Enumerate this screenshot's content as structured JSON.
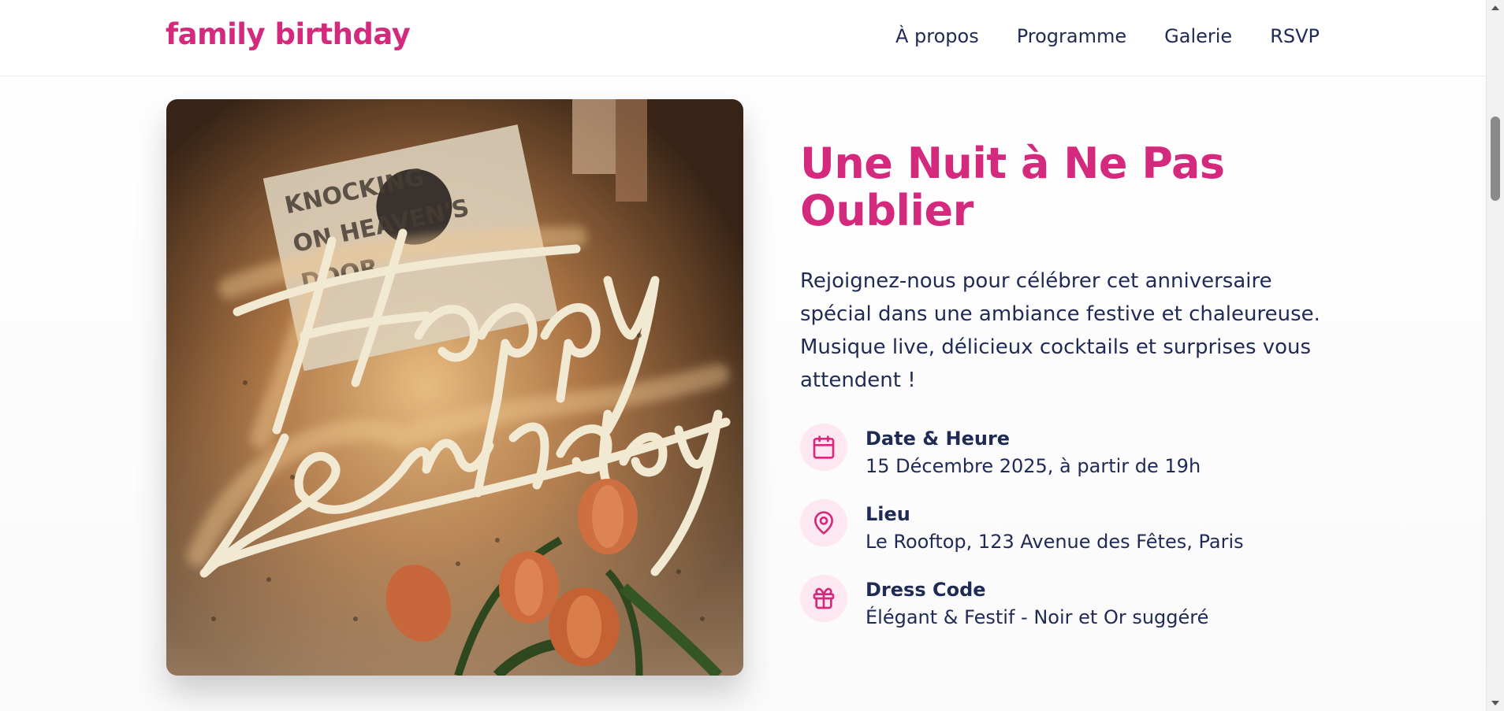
{
  "header": {
    "brand": "family birthday",
    "nav": [
      "À propos",
      "Programme",
      "Galerie",
      "RSVP"
    ]
  },
  "hero": {
    "image_alt": "Happy Birthday neon sign with tulips"
  },
  "intro": {
    "title": "Une Nuit à Ne Pas Oublier",
    "description": "Rejoignez-nous pour célébrer cet anniversaire spécial dans une ambiance festive et chaleureuse. Musique live, délicieux cocktails et surprises vous attendent !"
  },
  "details": [
    {
      "icon": "calendar-icon",
      "label": "Date & Heure",
      "value": "15 Décembre 2025, à partir de 19h"
    },
    {
      "icon": "location-pin-icon",
      "label": "Lieu",
      "value": "Le Rooftop, 123 Avenue des Fêtes, Paris"
    },
    {
      "icon": "gift-icon",
      "label": "Dress Code",
      "value": "Élégant & Festif - Noir et Or suggéré"
    }
  ],
  "colors": {
    "accent": "#d42a7e",
    "text": "#1f2a55",
    "icon_bg": "#fde7f1"
  }
}
